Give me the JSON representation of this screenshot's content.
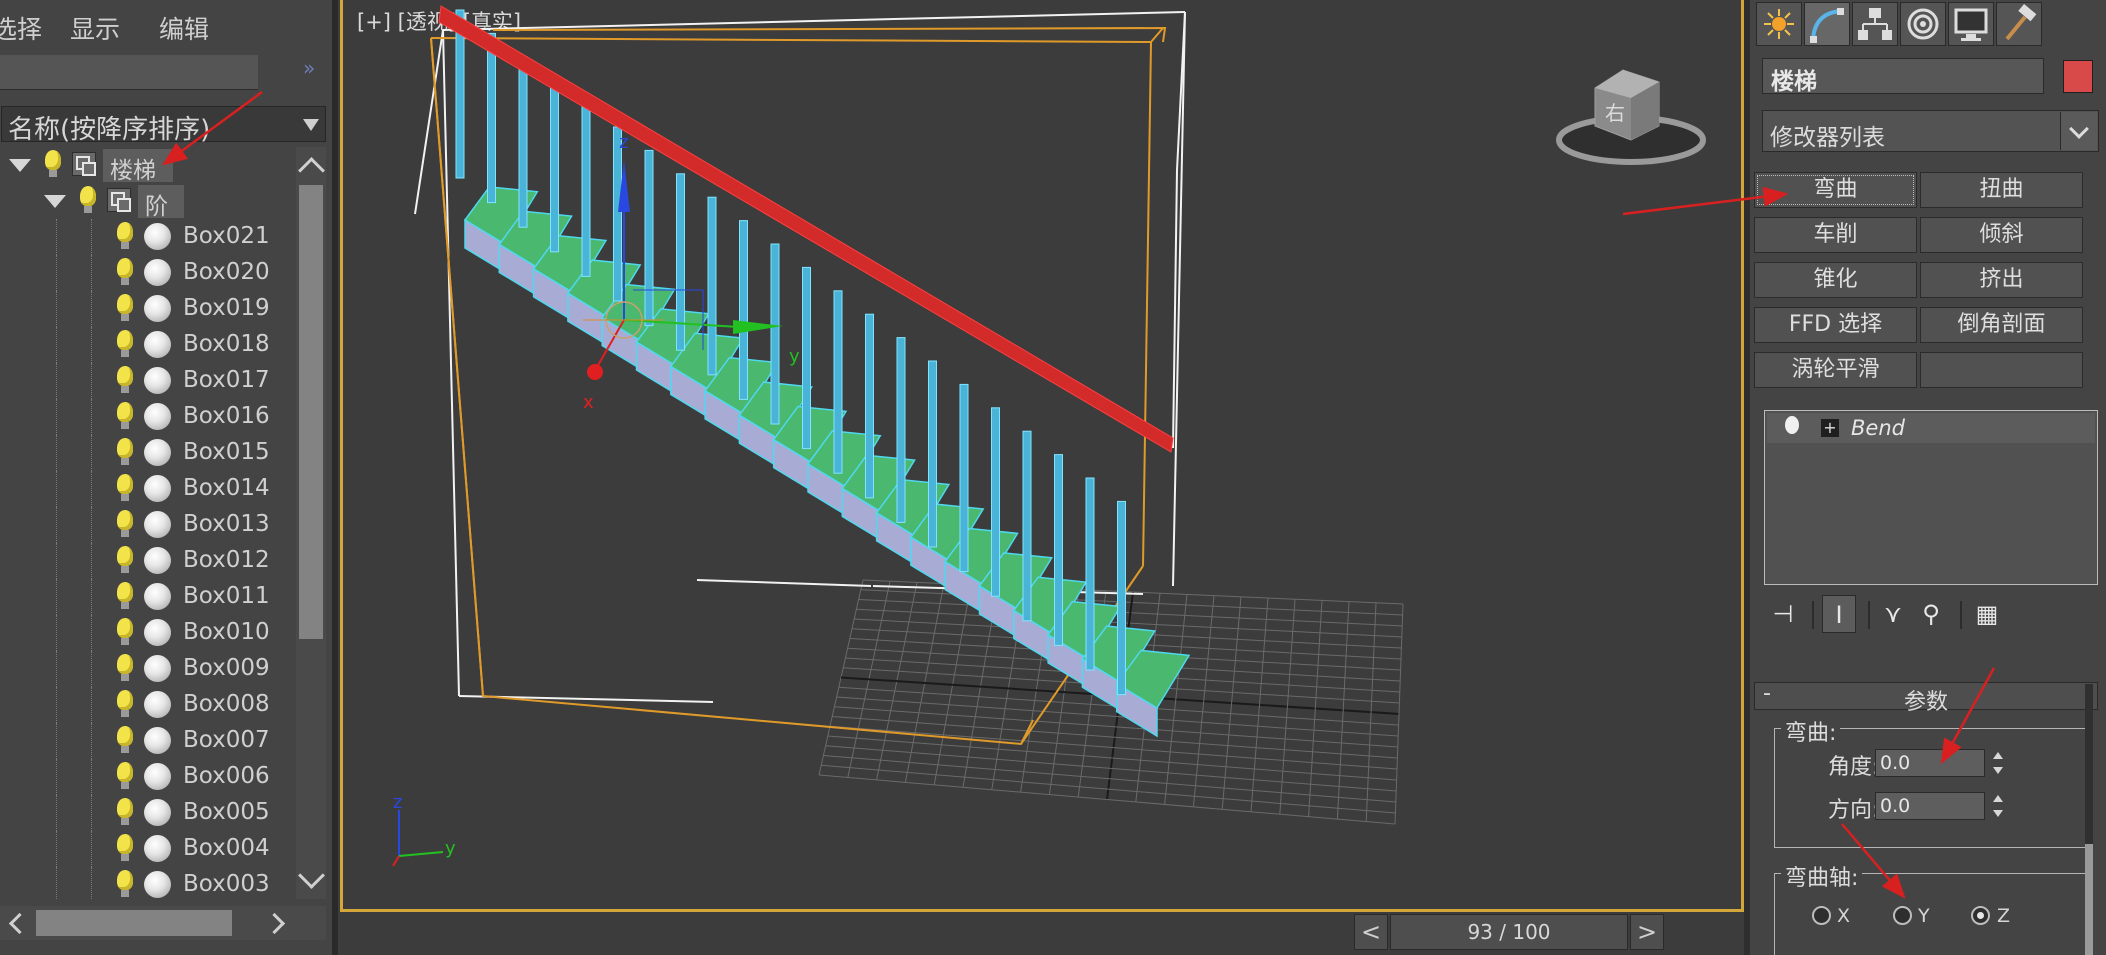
{
  "left_panel": {
    "menu": [
      "选择",
      "显示",
      "编辑"
    ],
    "expand_glyph": "»",
    "sort_label": "名称(按降序排序)",
    "tree": [
      {
        "label": "楼梯",
        "level": 0,
        "type": "group",
        "expanded": true,
        "selected": true
      },
      {
        "label": "阶",
        "level": 1,
        "type": "group",
        "expanded": true,
        "selected": true
      },
      {
        "label": "Box021",
        "level": 2,
        "type": "object"
      },
      {
        "label": "Box020",
        "level": 2,
        "type": "object"
      },
      {
        "label": "Box019",
        "level": 2,
        "type": "object"
      },
      {
        "label": "Box018",
        "level": 2,
        "type": "object"
      },
      {
        "label": "Box017",
        "level": 2,
        "type": "object"
      },
      {
        "label": "Box016",
        "level": 2,
        "type": "object"
      },
      {
        "label": "Box015",
        "level": 2,
        "type": "object"
      },
      {
        "label": "Box014",
        "level": 2,
        "type": "object"
      },
      {
        "label": "Box013",
        "level": 2,
        "type": "object"
      },
      {
        "label": "Box012",
        "level": 2,
        "type": "object"
      },
      {
        "label": "Box011",
        "level": 2,
        "type": "object"
      },
      {
        "label": "Box010",
        "level": 2,
        "type": "object"
      },
      {
        "label": "Box009",
        "level": 2,
        "type": "object"
      },
      {
        "label": "Box008",
        "level": 2,
        "type": "object"
      },
      {
        "label": "Box007",
        "level": 2,
        "type": "object"
      },
      {
        "label": "Box006",
        "level": 2,
        "type": "object"
      },
      {
        "label": "Box005",
        "level": 2,
        "type": "object"
      },
      {
        "label": "Box004",
        "level": 2,
        "type": "object"
      },
      {
        "label": "Box003",
        "level": 2,
        "type": "object"
      }
    ]
  },
  "viewport": {
    "label": "[+] [透视] [真实]",
    "axis_labels": {
      "z": "z",
      "y": "y",
      "x": "x"
    },
    "gizmo_text": "右"
  },
  "timeline": {
    "prev": "<",
    "next": ">",
    "frame_text": "93 / 100",
    "frame": 93,
    "total": 100
  },
  "command_panel": {
    "object_name": "楼梯",
    "object_color": "#d84a4a",
    "modifier_list_label": "修改器列表",
    "modifier_buttons": [
      "弯曲",
      "扭曲",
      "车削",
      "倾斜",
      "锥化",
      "挤出",
      "FFD 选择",
      "倒角剖面",
      "涡轮平滑",
      ""
    ],
    "stack": [
      {
        "name": "Bend",
        "expand": "+"
      }
    ],
    "rollout_collapse": "-",
    "rollout_title": "参数",
    "bend_group": "弯曲:",
    "angle_label": "角度:",
    "angle_value": "0.0",
    "direction_label": "方向:",
    "direction_value": "0.0",
    "axis_group": "弯曲轴:",
    "axes": [
      "X",
      "Y",
      "Z"
    ],
    "selected_axis": "Z"
  },
  "colors": {
    "viewport_border": "#d4a73a",
    "tread_green": "#4ab86e",
    "riser_lavender": "#a8acd4",
    "baluster_blue": "#4ab4d8",
    "handrail_red": "#d32a2a",
    "annotation_arrow": "#d82020"
  }
}
